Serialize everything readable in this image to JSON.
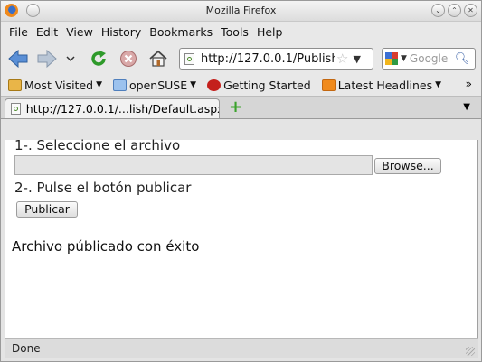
{
  "window": {
    "title": "Mozilla Firefox"
  },
  "menubar": {
    "items": [
      {
        "label": "File"
      },
      {
        "label": "Edit"
      },
      {
        "label": "View"
      },
      {
        "label": "History"
      },
      {
        "label": "Bookmarks"
      },
      {
        "label": "Tools"
      },
      {
        "label": "Help"
      }
    ]
  },
  "navbar": {
    "url": "http://127.0.0.1/Publish/",
    "search_placeholder": "Google"
  },
  "bookmarks": {
    "items": [
      {
        "label": "Most Visited",
        "icon": "most-visited-icon",
        "dropdown": true
      },
      {
        "label": "openSUSE",
        "icon": "folder-icon",
        "dropdown": true
      },
      {
        "label": "Getting Started",
        "icon": "getting-started-icon",
        "dropdown": false
      },
      {
        "label": "Latest Headlines",
        "icon": "rss-icon",
        "dropdown": true
      }
    ],
    "overflow": "»"
  },
  "tabs": [
    {
      "title": "http://127.0.0.1/...lish/Default.aspx",
      "active": true
    }
  ],
  "content": {
    "step1": "1-. Seleccione el archivo",
    "browse_label": "Browse...",
    "step2": "2-. Pulse el botón publicar",
    "publish_label": "Publicar",
    "result": "Archivo públicado con éxito"
  },
  "statusbar": {
    "text": "Done"
  }
}
